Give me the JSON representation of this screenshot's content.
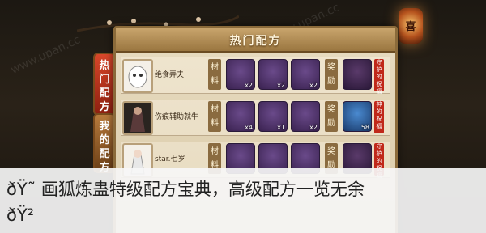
{
  "lantern_glyph": "喜",
  "watermark": "www.upan.cc",
  "panel": {
    "title": "热门配方"
  },
  "side_tabs": [
    {
      "label": "热门配方",
      "chars": [
        "热",
        "门",
        "配",
        "方"
      ]
    },
    {
      "label": "我的配方",
      "chars": [
        "我",
        "的",
        "配",
        "方"
      ]
    }
  ],
  "rows": [
    {
      "player": "绝食弄夫",
      "materials_label": "材料",
      "materials": [
        {
          "icon": "mooncake-icon",
          "count": "x2"
        },
        {
          "icon": "pot-icon",
          "count": "x2"
        },
        {
          "icon": "pig-icon",
          "count": "x2"
        }
      ],
      "reward_label": "奖励",
      "reward": {
        "icon": "purple-orb-icon",
        "tag": "守护的祝福"
      }
    },
    {
      "player": "伤痕辅助就牛",
      "materials_label": "材料",
      "materials": [
        {
          "icon": "mooncake-icon",
          "count": "x4"
        },
        {
          "icon": "pot-icon",
          "count": "x1"
        },
        {
          "icon": "pig-icon",
          "count": "x2"
        }
      ],
      "reward_label": "奖励",
      "reward": {
        "icon": "blue-crystal-icon",
        "count": "58",
        "tag": "神的祝福"
      }
    },
    {
      "player": "star.七岁",
      "materials_label": "材料",
      "materials": [
        {
          "icon": "mooncake-icon",
          "count": ""
        },
        {
          "icon": "pot-icon",
          "count": ""
        },
        {
          "icon": "pig-icon",
          "count": ""
        }
      ],
      "reward_label": "奖励",
      "reward": {
        "icon": "purple-orb-icon",
        "tag": "守护的祝福"
      }
    }
  ],
  "caption": {
    "line1": "ðŸ˜ 画狐炼蛊特级配方宝典，高级配方一览无余",
    "line2": "ðŸ²"
  },
  "colors": {
    "panel_bg": "#e8dcc2",
    "header": "#b08a50",
    "hot_tab": "#c83a22",
    "reward_tag": "#c0281a"
  }
}
